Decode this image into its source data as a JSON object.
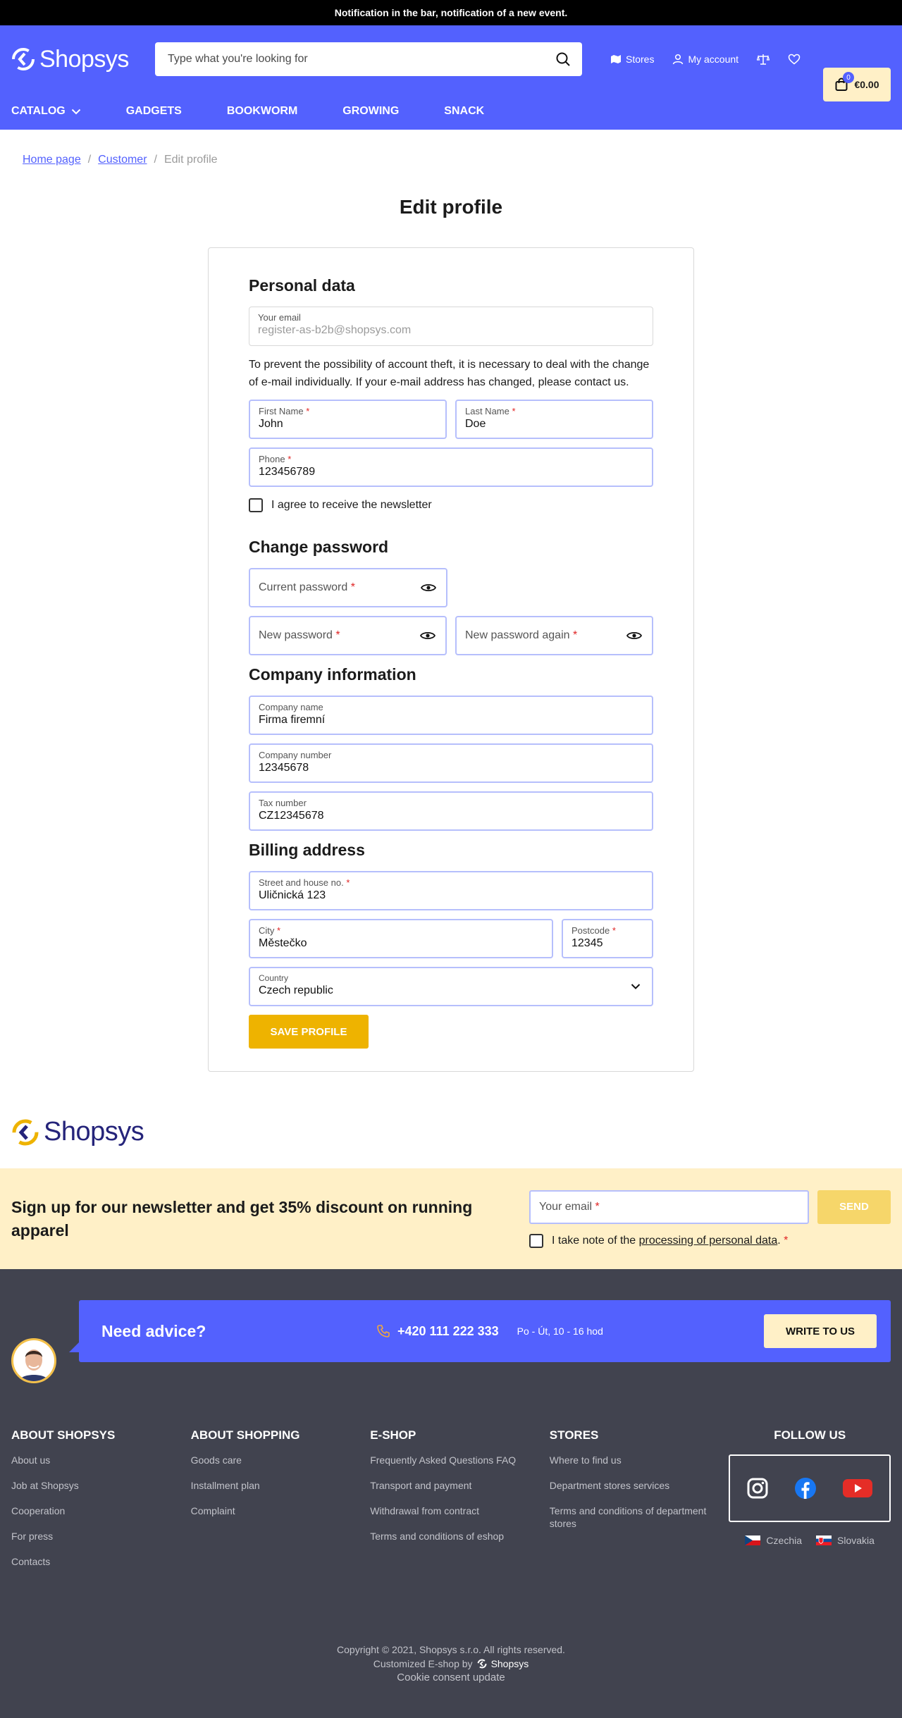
{
  "notification": "Notification in the bar, notification of a new event.",
  "header": {
    "logo_text": "Shopsys",
    "search_placeholder": "Type what you're looking for",
    "stores_label": "Stores",
    "account_label": "My account",
    "cart_count": "0",
    "cart_total": "€0.00"
  },
  "nav": [
    {
      "label": "Catalog"
    },
    {
      "label": "Gadgets"
    },
    {
      "label": "Bookworm"
    },
    {
      "label": "Growing"
    },
    {
      "label": "Snack"
    }
  ],
  "breadcrumb": {
    "home": "Home page",
    "customer": "Customer",
    "current": "Edit profile",
    "sep": "/"
  },
  "page_title": "Edit profile",
  "form": {
    "personal_title": "Personal data",
    "email_label": "Your email",
    "email_value": "register-as-b2b@shopsys.com",
    "note": "To prevent the possibility of account theft, it is necessary to deal with the change of e-mail individually. If your e-mail address has changed, please contact us.",
    "first_name_label": "First Name",
    "first_name_value": "John",
    "last_name_label": "Last Name",
    "last_name_value": "Doe",
    "phone_label": "Phone",
    "phone_value": "123456789",
    "newsletter_label": "I agree to receive the newsletter",
    "password_title": "Change password",
    "current_password_label": "Current password",
    "new_password_label": "New password",
    "new_password_again_label": "New password again",
    "company_title": "Company information",
    "company_name_label": "Company name",
    "company_name_value": "Firma firemní",
    "company_number_label": "Company number",
    "company_number_value": "12345678",
    "tax_number_label": "Tax number",
    "tax_number_value": "CZ12345678",
    "billing_title": "Billing address",
    "street_label": "Street and house no.",
    "street_value": "Uličnická 123",
    "city_label": "City",
    "city_value": "Městečko",
    "postcode_label": "Postcode",
    "postcode_value": "12345",
    "country_label": "Country",
    "country_value": "Czech republic",
    "required_mark": "*",
    "save_label": "Save profile"
  },
  "footer_logo": "Shopsys",
  "newsletter": {
    "text": "Sign up for our newsletter and get 35% discount on running apparel",
    "email_placeholder": "Your email",
    "send_label": "SEND",
    "consent_prefix": "I take note of the",
    "consent_link": "processing of personal data",
    "consent_suffix": "."
  },
  "advice": {
    "title": "Need advice?",
    "phone": "+420 111 222 333",
    "hours": "Po - Út, 10 - 16 hod",
    "button": "WRITE TO US"
  },
  "footer_cols": [
    {
      "title": "About Shopsys",
      "links": [
        "About us",
        "Job at Shopsys",
        "Cooperation",
        "For press",
        "Contacts"
      ]
    },
    {
      "title": "About shopping",
      "links": [
        "Goods care",
        "Installment plan",
        "Complaint"
      ]
    },
    {
      "title": "E-shop",
      "links": [
        "Frequently Asked Questions FAQ",
        "Transport and payment",
        "Withdrawal from contract",
        "Terms and conditions of eshop"
      ]
    },
    {
      "title": "Stores",
      "links": [
        "Where to find us",
        "Department stores services",
        "Terms and conditions of department stores"
      ]
    }
  ],
  "follow": {
    "title": "Follow us",
    "langs": [
      "Czechia",
      "Slovakia"
    ]
  },
  "copyright": "Copyright © 2021, Shopsys s.r.o. All rights reserved.",
  "customized_by": "Customized E-shop by",
  "customized_brand": "Shopsys",
  "cookie": "Cookie consent update",
  "colors": {
    "primary": "#5361fe",
    "accent_yellow": "#eeb300",
    "cream": "#fff0c7",
    "footer_bg": "#41434f"
  }
}
